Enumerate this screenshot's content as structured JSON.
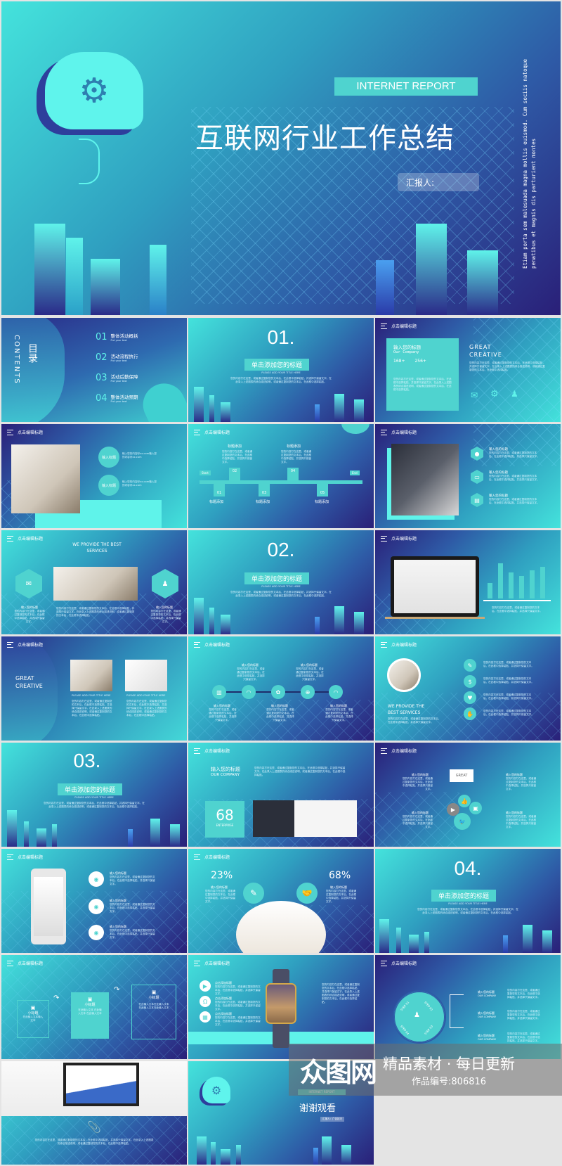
{
  "cover": {
    "badge": "INTERNET REPORT",
    "title": "互联网行业工作总结",
    "reporter": "汇报人:",
    "side_text_1": "Etiam porta sem malesuada magna mollis euismod. Cum sociis natoque",
    "side_text_2": "penatibus et magnis dis parturient montes"
  },
  "common": {
    "slide_header": "点击编辑标题",
    "subtitle_en": "PLEASE ADD YOUR TITLE HERE",
    "filler": "您的内容打在这里，或者通过复制您的文本后，在此框中选择粘贴，并选择只保留文字。",
    "filler_long": "您的内容打在这里，或者通过复制您的文本后，在此框中选择粘贴，并选择只保留文字。在此录入上述图表的综合描述说明，或者通过复制您的文本后，在此框中选择粘贴。",
    "item_title": "输入您的标题",
    "add_title": "标题添加",
    "click_add_title": "点击添加标题"
  },
  "contents": {
    "title_cn": "目录",
    "title_en": "CONTENTS",
    "items": [
      {
        "num": "01",
        "label": "整体活动概括",
        "sub": "Put your text"
      },
      {
        "num": "02",
        "label": "活动流程执行",
        "sub": "Put your text"
      },
      {
        "num": "03",
        "label": "活动后勤保障",
        "sub": "Put your text"
      },
      {
        "num": "04",
        "label": "整体活动预期",
        "sub": "Put your text"
      }
    ]
  },
  "sections": [
    {
      "num": "01.",
      "title": "单击添加您的标题"
    },
    {
      "num": "02.",
      "title": "单击添加您的标题"
    },
    {
      "num": "03.",
      "title": "单击添加您的标题"
    },
    {
      "num": "04.",
      "title": "单击添加您的标题"
    }
  ],
  "company": {
    "box_title": "输入您的标题",
    "box_sub": "Our Company",
    "stat1": "168+",
    "stat2": "256+",
    "heading": "GREAT CREATIVE",
    "icons": [
      "mail-icon",
      "gear-icon",
      "user-icon"
    ]
  },
  "input_slide": {
    "bubble": "输入标题",
    "text": "输入您的内容@xx.com输入您的内容@xx.com"
  },
  "timeline": {
    "start": "Start",
    "end": "End",
    "steps": [
      "01",
      "02",
      "03",
      "04",
      "05"
    ]
  },
  "services": {
    "heading": "WE PROVIDE THE BEST SERVICES"
  },
  "bar_chart": {
    "levels": [
      0.45,
      1.0,
      0.75,
      0.65,
      0.8,
      0.9
    ]
  },
  "creative": {
    "heading": "GREAT CREATIVE"
  },
  "enterprise": {
    "title": "输入您的标题",
    "sub": "OUR COMPANY",
    "number": "68",
    "label": "ENTERPRISE"
  },
  "social": {
    "label": "GREAT"
  },
  "percent": {
    "left": "23%",
    "right": "68%"
  },
  "boxes": {
    "title": "小标题",
    "b1": "在此输入文本输入文本",
    "b2": "在此输入文本 在此输入文本 在此输入文本",
    "b3": "在此输入文本在此输入文本在此输入文本在此输入文本"
  },
  "steps": {
    "labels": [
      "STEP 01",
      "STEP 02",
      "STEP 03",
      "STEP 04"
    ],
    "item_sub": "OUR COMPANY"
  },
  "thanks": {
    "badge": "INTERNET REPORT",
    "title": "谢谢观看",
    "reporter": "汇报人：广告技巧"
  },
  "watermark": {
    "logo": "众图网",
    "slogan": "精品素材 · 每日更新",
    "code": "作品编号:806816"
  }
}
